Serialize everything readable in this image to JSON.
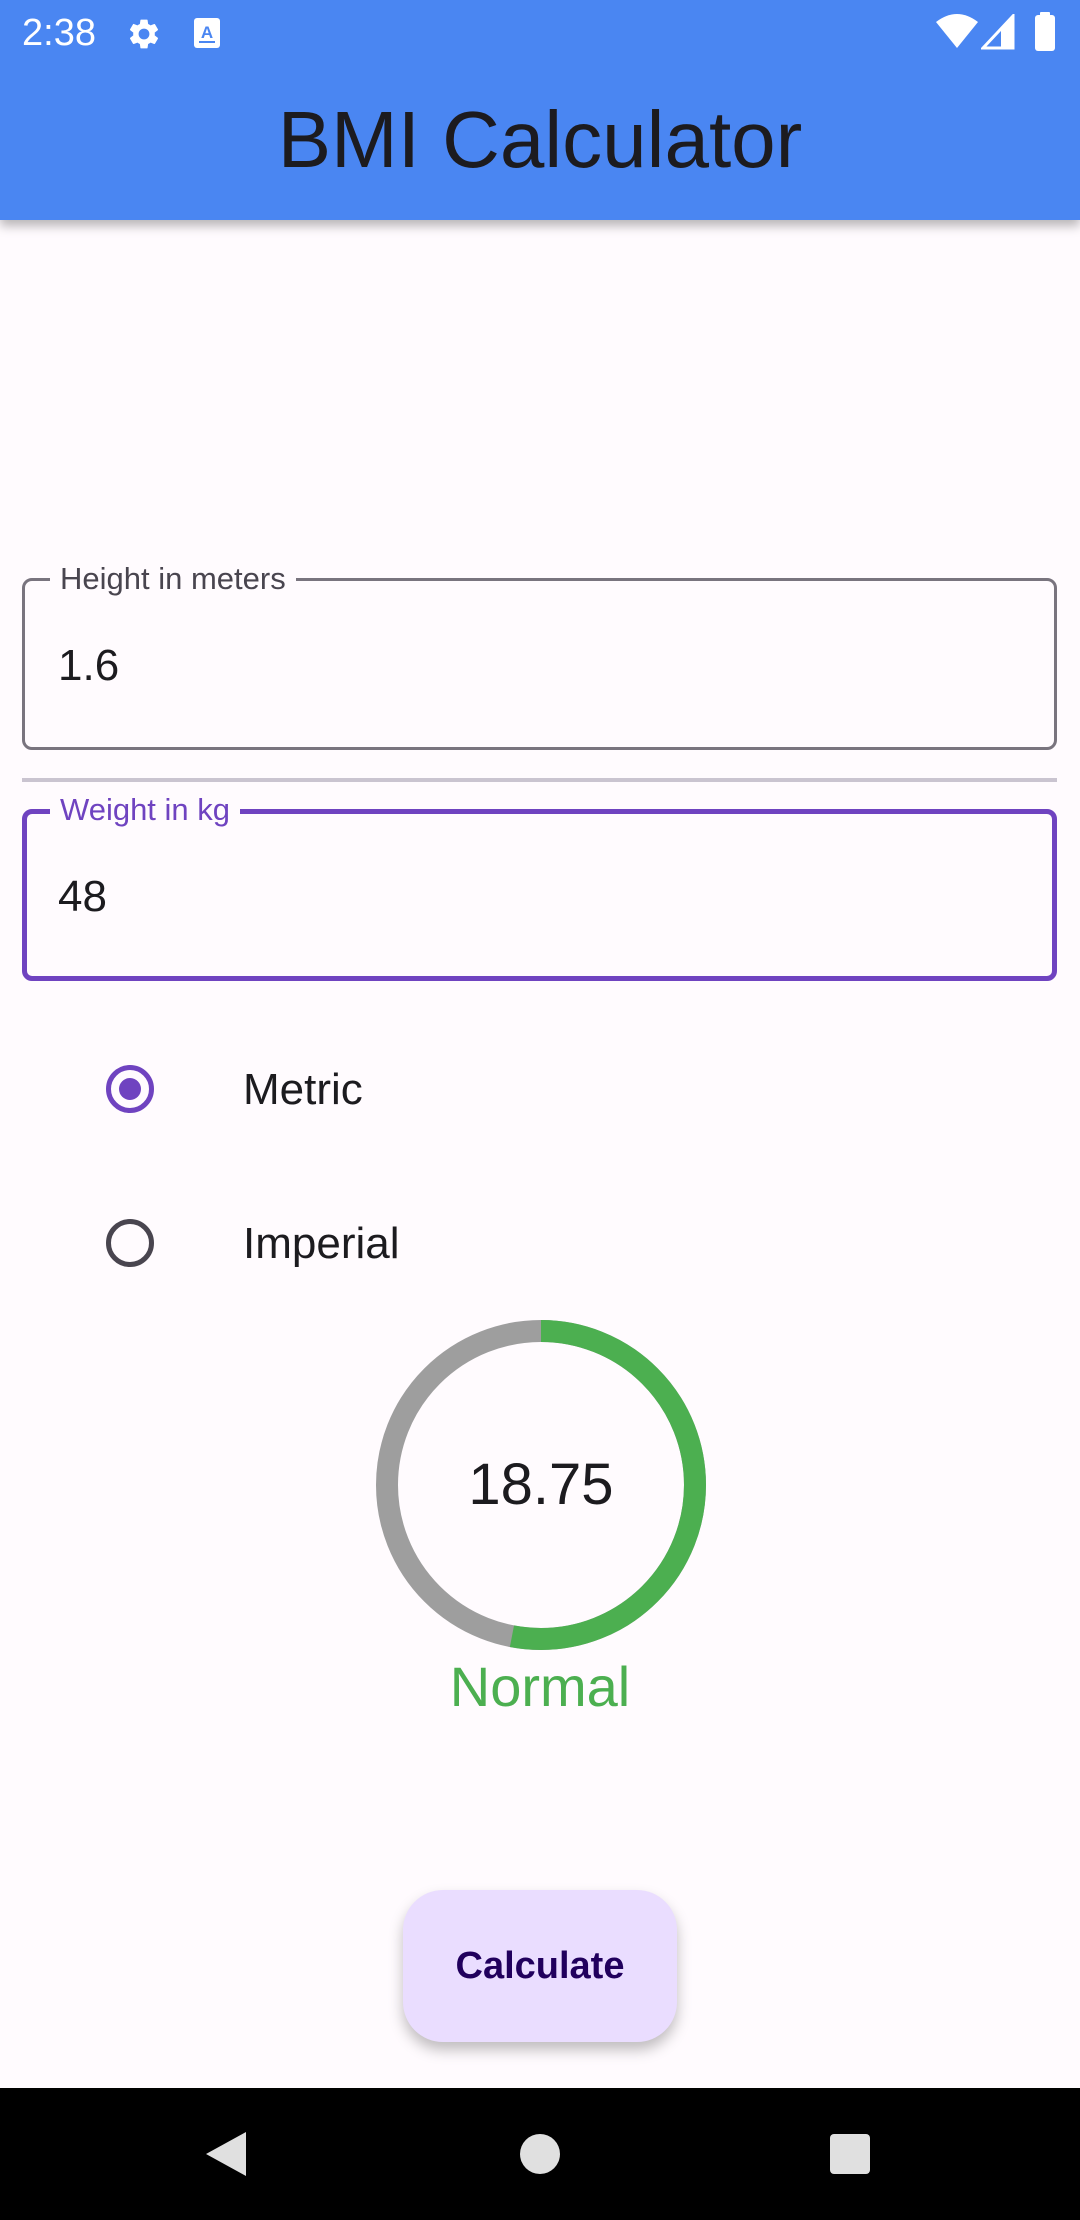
{
  "status_bar": {
    "time": "2:38",
    "icons": [
      "gear-icon",
      "font-app-icon",
      "wifi-icon",
      "signal-icon",
      "battery-icon"
    ]
  },
  "app_bar": {
    "title": "BMI Calculator",
    "color": "#4a86f2"
  },
  "form": {
    "height": {
      "label": "Height in meters",
      "value": "1.6"
    },
    "weight": {
      "label": "Weight in kg",
      "value": "48"
    },
    "units": {
      "options": [
        {
          "label": "Metric",
          "selected": true
        },
        {
          "label": "Imperial",
          "selected": false
        }
      ]
    }
  },
  "result": {
    "bmi": "18.75",
    "category": "Normal",
    "gauge_fill_fraction": 0.53,
    "gauge_fill_color": "#4caf50",
    "gauge_track_color": "#9e9e9e",
    "category_color": "#4caf50"
  },
  "actions": {
    "calculate_label": "Calculate"
  },
  "nav_bar": {
    "buttons": [
      "back-icon",
      "home-icon",
      "recents-icon"
    ]
  },
  "colors": {
    "accent": "#6f43c0",
    "button_bg": "#eaddff",
    "button_text": "#21005d"
  }
}
